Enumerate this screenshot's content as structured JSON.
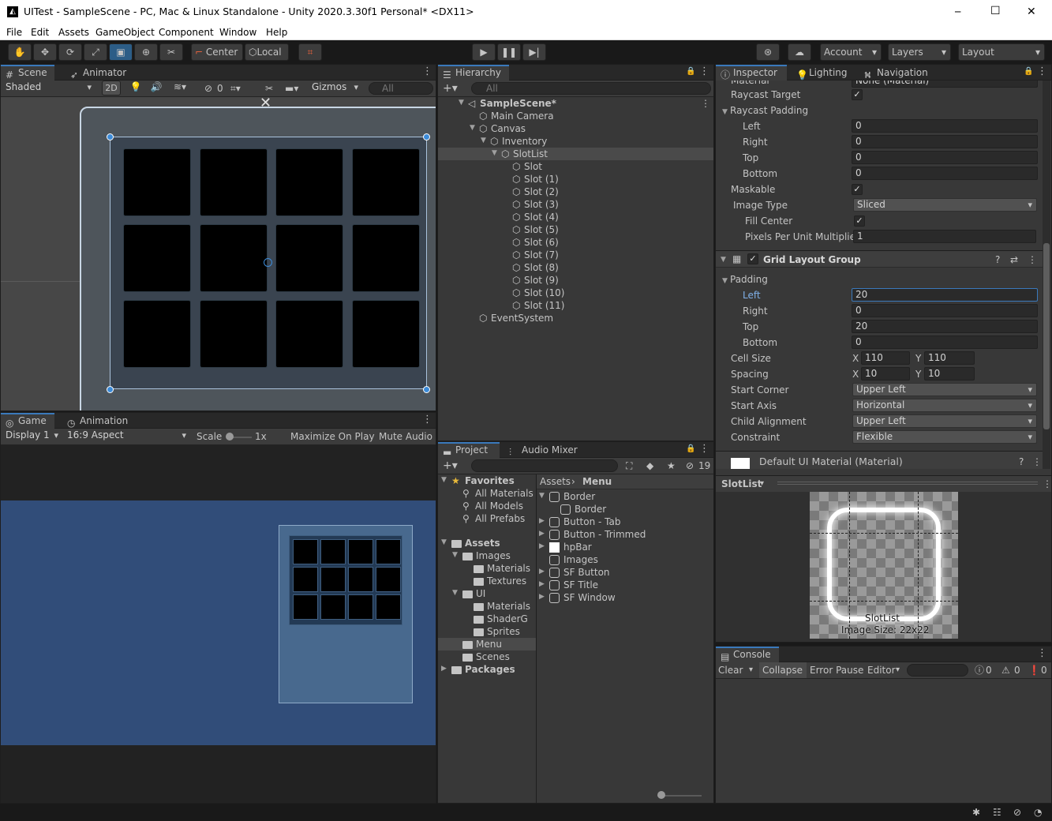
{
  "window": {
    "title": "UITest - SampleScene - PC, Mac & Linux Standalone - Unity 2020.3.30f1 Personal* <DX11>",
    "controls": {
      "minimize": "─",
      "maximize": "☐",
      "close": "✕"
    }
  },
  "menu": [
    "File",
    "Edit",
    "Assets",
    "GameObject",
    "Component",
    "Window",
    "Help"
  ],
  "toolbar": {
    "center": "Center",
    "local": "Local",
    "account": "Account",
    "layers": "Layers",
    "layout": "Layout"
  },
  "scene": {
    "tabs": [
      "Scene",
      "Animator"
    ],
    "shading": "Shaded",
    "mode_2d": "2D",
    "hidden_count": "0",
    "gizmos": "Gizmos",
    "search_placeholder": "All"
  },
  "game": {
    "tabs": [
      "Game",
      "Animation"
    ],
    "display": "Display 1",
    "aspect": "16:9 Aspect",
    "scale_label": "Scale",
    "scale_value": "1x",
    "maximize": "Maximize On Play",
    "mute": "Mute Audio"
  },
  "hierarchy": {
    "tab": "Hierarchy",
    "search_placeholder": "All",
    "items": [
      {
        "label": "SampleScene*",
        "depth": 0,
        "expanded": true,
        "scene": true
      },
      {
        "label": "Main Camera",
        "depth": 1
      },
      {
        "label": "Canvas",
        "depth": 1,
        "expanded": true
      },
      {
        "label": "Inventory",
        "depth": 2,
        "expanded": true
      },
      {
        "label": "SlotList",
        "depth": 3,
        "expanded": true,
        "selected": true
      },
      {
        "label": "Slot",
        "depth": 4
      },
      {
        "label": "Slot (1)",
        "depth": 4
      },
      {
        "label": "Slot (2)",
        "depth": 4
      },
      {
        "label": "Slot (3)",
        "depth": 4
      },
      {
        "label": "Slot (4)",
        "depth": 4
      },
      {
        "label": "Slot (5)",
        "depth": 4
      },
      {
        "label": "Slot (6)",
        "depth": 4
      },
      {
        "label": "Slot (7)",
        "depth": 4
      },
      {
        "label": "Slot (8)",
        "depth": 4
      },
      {
        "label": "Slot (9)",
        "depth": 4
      },
      {
        "label": "Slot (10)",
        "depth": 4
      },
      {
        "label": "Slot (11)",
        "depth": 4
      },
      {
        "label": "EventSystem",
        "depth": 1
      }
    ]
  },
  "project": {
    "tabs": [
      "Project",
      "Audio Mixer"
    ],
    "hidden_count": "19",
    "favorites": {
      "label": "Favorites",
      "items": [
        "All Materials",
        "All Models",
        "All Prefabs"
      ]
    },
    "tree": [
      {
        "label": "Assets",
        "depth": 0,
        "bold": true
      },
      {
        "label": "Images",
        "depth": 1
      },
      {
        "label": "Materials",
        "depth": 2
      },
      {
        "label": "Textures",
        "depth": 2
      },
      {
        "label": "UI",
        "depth": 1
      },
      {
        "label": "Materials",
        "depth": 2
      },
      {
        "label": "ShaderG",
        "depth": 2
      },
      {
        "label": "Sprites",
        "depth": 2
      },
      {
        "label": "Menu",
        "depth": 1,
        "selected": true
      },
      {
        "label": "Scenes",
        "depth": 1
      },
      {
        "label": "Packages",
        "depth": 0,
        "bold": true
      }
    ],
    "breadcrumb": [
      "Assets",
      "Menu"
    ],
    "assets": [
      {
        "label": "Border",
        "expand": "open"
      },
      {
        "label": "Border",
        "child": true
      },
      {
        "label": "Button - Tab",
        "expand": "closed"
      },
      {
        "label": "Button - Trimmed",
        "expand": "closed"
      },
      {
        "label": "hpBar",
        "expand": "closed"
      },
      {
        "label": "Images",
        "expand": "none"
      },
      {
        "label": "SF Button",
        "expand": "closed"
      },
      {
        "label": "SF Title",
        "expand": "closed"
      },
      {
        "label": "SF Window",
        "expand": "closed"
      }
    ]
  },
  "inspector": {
    "tabs": [
      "Inspector",
      "Lighting",
      "Navigation"
    ],
    "cut_label": "Material",
    "cut_value": "None (Material)",
    "raycast_target": "Raycast Target",
    "raycast_padding": "Raycast Padding",
    "rp": [
      {
        "label": "Left",
        "value": "0"
      },
      {
        "label": "Right",
        "value": "0"
      },
      {
        "label": "Top",
        "value": "0"
      },
      {
        "label": "Bottom",
        "value": "0"
      }
    ],
    "maskable": "Maskable",
    "image_type": {
      "label": "Image Type",
      "value": "Sliced"
    },
    "fill_center": "Fill Center",
    "ppu": {
      "label": "Pixels Per Unit Multiplier",
      "value": "1"
    },
    "grid": {
      "title": "Grid Layout Group",
      "padding": "Padding",
      "pad": [
        {
          "label": "Left",
          "value": "20"
        },
        {
          "label": "Right",
          "value": "0"
        },
        {
          "label": "Top",
          "value": "20"
        },
        {
          "label": "Bottom",
          "value": "0"
        }
      ],
      "cell_size": {
        "label": "Cell Size",
        "x": "110",
        "y": "110"
      },
      "spacing": {
        "label": "Spacing",
        "x": "10",
        "y": "10"
      },
      "start_corner": {
        "label": "Start Corner",
        "value": "Upper Left"
      },
      "start_axis": {
        "label": "Start Axis",
        "value": "Horizontal"
      },
      "child_alignment": {
        "label": "Child Alignment",
        "value": "Upper Left"
      },
      "constraint": {
        "label": "Constraint",
        "value": "Flexible"
      },
      "x_label": "X",
      "y_label": "Y"
    },
    "material": "Default UI Material (Material)",
    "preview": {
      "object": "SlotList",
      "name": "SlotList",
      "size": "Image Size: 22x22"
    }
  },
  "console": {
    "tab": "Console",
    "clear": "Clear",
    "collapse": "Collapse",
    "error_pause": "Error Pause",
    "editor": "Editor",
    "log_count": "0",
    "warn_count": "0",
    "error_count": "0"
  },
  "colors": {
    "accent": "#3a79bb",
    "selection": "#2c5d87",
    "game_bg": "#314d79"
  }
}
